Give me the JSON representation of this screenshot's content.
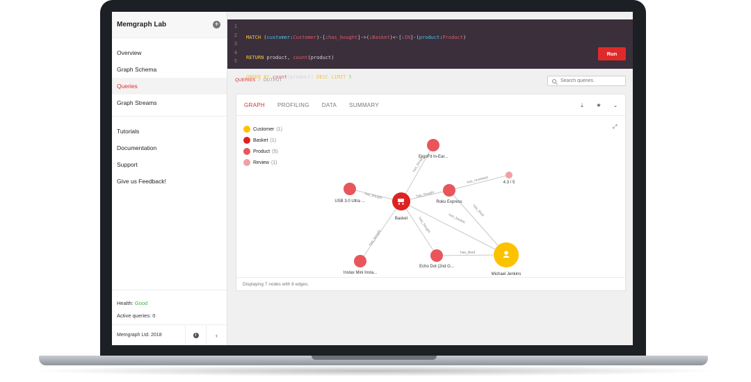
{
  "sidebar": {
    "title": "Memgraph Lab",
    "items": [
      {
        "label": "Overview"
      },
      {
        "label": "Graph Schema"
      },
      {
        "label": "Queries"
      },
      {
        "label": "Graph Streams"
      }
    ],
    "items2": [
      {
        "label": "Tutorials"
      },
      {
        "label": "Documentation"
      },
      {
        "label": "Support"
      },
      {
        "label": "Give us Feedback!"
      }
    ],
    "health_label": "Health:",
    "health_value": "Good",
    "active_queries": "Active queries: 0",
    "copyright": "Memgraph Ltd. 2018"
  },
  "editor": {
    "line_numbers": [
      "1",
      "2",
      "3",
      "4",
      "5"
    ],
    "run_label": "Run"
  },
  "breadcrumb": {
    "queries": "QUERIES",
    "sep": "/",
    "output": "OUTPUT"
  },
  "search": {
    "placeholder": "Search queries"
  },
  "tabs": [
    "GRAPH",
    "PROFILING",
    "DATA",
    "SUMMARY"
  ],
  "legend": [
    {
      "label": "Customer",
      "count": "(1)",
      "color": "#fcc200"
    },
    {
      "label": "Basket",
      "count": "(1)",
      "color": "#dd2222"
    },
    {
      "label": "Product",
      "count": "(5)",
      "color": "#e8565c"
    },
    {
      "label": "Review",
      "count": "(1)",
      "color": "#f0a0a4"
    }
  ],
  "graph": {
    "nodes": [
      {
        "label": "Basket",
        "kind": "basket"
      },
      {
        "label": "ErgoFit In-Ear...",
        "kind": "product"
      },
      {
        "label": "USB 3.0 Ultra ...",
        "kind": "product"
      },
      {
        "label": "Roku Express",
        "kind": "product"
      },
      {
        "label": "Instax Mini Insta...",
        "kind": "product"
      },
      {
        "label": "Echo Dot (2nd G...",
        "kind": "product"
      },
      {
        "label": "Michael Jenkins",
        "kind": "customer"
      },
      {
        "label": "4.3 / 5",
        "kind": "review"
      }
    ],
    "edges": [
      {
        "label": "has_bought"
      },
      {
        "label": "has_bought"
      },
      {
        "label": "has_bought"
      },
      {
        "label": "has_bought"
      },
      {
        "label": "has_bought"
      },
      {
        "label": "has_basket"
      },
      {
        "label": "has_liked"
      },
      {
        "label": "has_liked"
      },
      {
        "label": "has_reviewed"
      }
    ]
  },
  "footer": "Displaying 7 nodes with 8 edges."
}
